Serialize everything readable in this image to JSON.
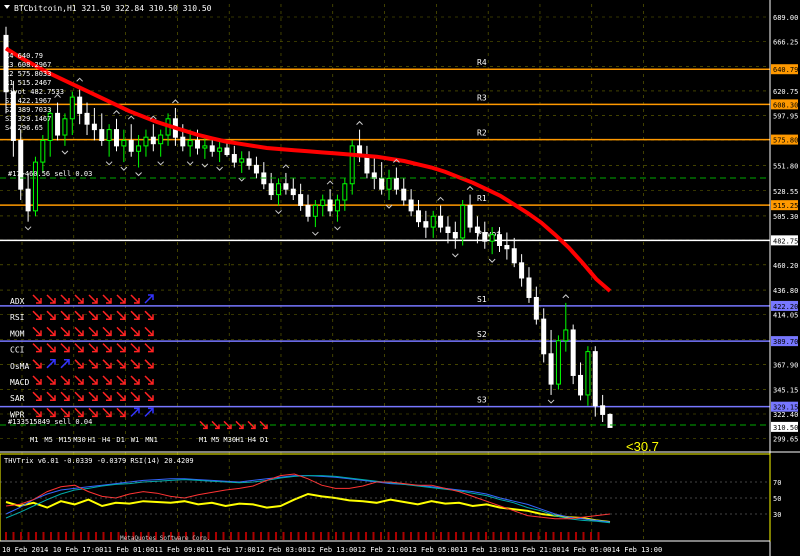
{
  "window": {
    "title": "BTCbitcoin,H1  321.50 322.84 310.50 310.50",
    "footer": "MetaQuotes Software Corp."
  },
  "colors": {
    "background": "#000000",
    "grid": "#6b6b00",
    "bull": "#00ff00",
    "bear": "#ffffff",
    "ma": "#ff0000",
    "pivot_line": "#ffffff",
    "res_line": "#ff9900",
    "sup_line": "#7777ff",
    "indicator_frame": "#ffff00"
  },
  "pivot_labels": [
    "R4 640.79",
    "R3 608.2967",
    "R2 575.8033",
    "R1 515.2467",
    "Pivot 482.7533",
    "S1 422.1967",
    "S2 389.7033",
    "S3 329.1467",
    "S4 296.65"
  ],
  "line_tags": {
    "R4": "R4",
    "R3": "R3",
    "R2": "R2",
    "R1": "R1",
    "Pivot": "Pivot",
    "S1": "S1",
    "S2": "S2",
    "S3": "S3"
  },
  "notes": {
    "sell_upper": "#17>460.56 sell 0.03",
    "sell_lower": "#133515849 sell 0.04",
    "big_label": "<30.7"
  },
  "mtf_table": {
    "rows": [
      "ADX",
      "RSI",
      "MOM",
      "CCI",
      "OsMA",
      "MACD",
      "SAR",
      "WPR"
    ],
    "periods_left": [
      "M1",
      "M5",
      "M15",
      "M30",
      "H1",
      "H4",
      "D1",
      "W1",
      "MN1"
    ],
    "periods_right": [
      "M1",
      "M5",
      "M30",
      "H1",
      "H4",
      "D1"
    ]
  },
  "indicator": {
    "label": "THVTrix v6.01 -0.0339 -0.0379  RSI(14) 20.4209",
    "levels": [
      "70",
      "50",
      "30"
    ]
  },
  "chart_data": [
    {
      "type": "candlestick",
      "title": "BTCbitcoin,H1",
      "symbol": "BTCbitcoin",
      "timeframe": "H1",
      "ohlc_header": {
        "open": 321.5,
        "high": 322.84,
        "low": 310.5,
        "close": 310.5
      },
      "y_ticks": [
        689.0,
        666.25,
        643.5,
        620.75,
        597.95,
        575.2,
        551.8,
        528.55,
        505.3,
        483.05,
        460.2,
        436.8,
        414.05,
        391.3,
        367.9,
        345.15,
        322.4,
        299.65
      ],
      "ylim": [
        291,
        701
      ],
      "x_ticks": [
        "10 Feb 2014",
        "10 Feb 17:00",
        "11 Feb 01:00",
        "11 Feb 09:00",
        "11 Feb 17:00",
        "12 Feb 03:00",
        "12 Feb 13:00",
        "12 Feb 21:00",
        "13 Feb 05:00",
        "13 Feb 13:00",
        "13 Feb 21:00",
        "14 Feb 05:00",
        "14 Feb 13:00"
      ],
      "price_tags": [
        {
          "label": "640.79",
          "value": 640.79,
          "kind": "res"
        },
        {
          "label": "608.30",
          "value": 608.3,
          "kind": "res"
        },
        {
          "label": "575.80",
          "value": 575.8,
          "kind": "res"
        },
        {
          "label": "515.25",
          "value": 515.25,
          "kind": "res"
        },
        {
          "label": "482.75",
          "value": 482.75,
          "kind": "pivot"
        },
        {
          "label": "422.20",
          "value": 422.2,
          "kind": "sup"
        },
        {
          "label": "389.70",
          "value": 389.7,
          "kind": "sup"
        },
        {
          "label": "329.15",
          "value": 329.15,
          "kind": "sup"
        },
        {
          "label": "310.50",
          "value": 310.5,
          "kind": "price"
        }
      ],
      "levels": {
        "R4": 640.79,
        "R3": 608.3,
        "R2": 575.8,
        "R1": 515.25,
        "Pivot": 482.75,
        "S1": 422.2,
        "S2": 389.7,
        "S3": 329.15
      },
      "candles": [
        [
          672,
          680,
          600,
          620
        ],
        [
          620,
          630,
          560,
          575
        ],
        [
          575,
          585,
          520,
          530
        ],
        [
          530,
          545,
          500,
          510
        ],
        [
          510,
          560,
          505,
          555
        ],
        [
          555,
          580,
          545,
          575
        ],
        [
          575,
          605,
          560,
          600
        ],
        [
          600,
          610,
          575,
          580
        ],
        [
          580,
          600,
          570,
          595
        ],
        [
          595,
          620,
          580,
          615
        ],
        [
          615,
          625,
          590,
          600
        ],
        [
          600,
          610,
          580,
          590
        ],
        [
          590,
          605,
          575,
          585
        ],
        [
          585,
          600,
          570,
          575
        ],
        [
          575,
          590,
          560,
          585
        ],
        [
          585,
          595,
          565,
          570
        ],
        [
          570,
          585,
          555,
          575
        ],
        [
          575,
          590,
          560,
          565
        ],
        [
          565,
          580,
          550,
          570
        ],
        [
          570,
          585,
          560,
          578
        ],
        [
          578,
          590,
          565,
          572
        ],
        [
          572,
          585,
          560,
          580
        ],
        [
          580,
          600,
          570,
          595
        ],
        [
          595,
          605,
          570,
          578
        ],
        [
          578,
          590,
          565,
          570
        ],
        [
          570,
          585,
          560,
          575
        ],
        [
          575,
          585,
          562,
          568
        ],
        [
          568,
          580,
          558,
          570
        ],
        [
          570,
          578,
          560,
          565
        ],
        [
          565,
          575,
          555,
          568
        ],
        [
          568,
          575,
          560,
          562
        ],
        [
          562,
          570,
          550,
          555
        ],
        [
          555,
          565,
          545,
          558
        ],
        [
          558,
          565,
          548,
          552
        ],
        [
          552,
          560,
          540,
          545
        ],
        [
          545,
          555,
          530,
          535
        ],
        [
          535,
          545,
          520,
          525
        ],
        [
          525,
          540,
          515,
          535
        ],
        [
          535,
          545,
          525,
          530
        ],
        [
          530,
          540,
          520,
          525
        ],
        [
          525,
          535,
          510,
          515
        ],
        [
          515,
          525,
          500,
          505
        ],
        [
          505,
          520,
          495,
          515
        ],
        [
          515,
          525,
          505,
          520
        ],
        [
          520,
          530,
          505,
          510
        ],
        [
          510,
          525,
          500,
          520
        ],
        [
          520,
          540,
          510,
          535
        ],
        [
          535,
          575,
          525,
          570
        ],
        [
          570,
          585,
          555,
          560
        ],
        [
          560,
          570,
          540,
          545
        ],
        [
          545,
          560,
          530,
          540
        ],
        [
          540,
          555,
          525,
          530
        ],
        [
          530,
          548,
          520,
          540
        ],
        [
          540,
          550,
          525,
          530
        ],
        [
          530,
          540,
          515,
          520
        ],
        [
          520,
          530,
          505,
          510
        ],
        [
          510,
          520,
          495,
          500
        ],
        [
          500,
          510,
          485,
          495
        ],
        [
          495,
          510,
          485,
          505
        ],
        [
          505,
          515,
          490,
          495
        ],
        [
          495,
          505,
          480,
          490
        ],
        [
          490,
          500,
          475,
          485
        ],
        [
          485,
          520,
          478,
          515
        ],
        [
          515,
          525,
          490,
          495
        ],
        [
          495,
          505,
          480,
          490
        ],
        [
          490,
          500,
          475,
          482
        ],
        [
          482,
          495,
          470,
          488
        ],
        [
          488,
          495,
          472,
          478
        ],
        [
          478,
          490,
          465,
          475
        ],
        [
          475,
          485,
          458,
          462
        ],
        [
          462,
          470,
          440,
          448
        ],
        [
          448,
          458,
          425,
          430
        ],
        [
          430,
          440,
          405,
          410
        ],
        [
          410,
          420,
          370,
          378
        ],
        [
          378,
          400,
          340,
          350
        ],
        [
          350,
          395,
          345,
          390
        ],
        [
          390,
          425,
          380,
          400
        ],
        [
          400,
          405,
          350,
          358
        ],
        [
          358,
          370,
          335,
          340
        ],
        [
          340,
          385,
          330,
          380
        ],
        [
          380,
          385,
          320,
          330
        ],
        [
          330,
          340,
          315,
          322
        ],
        [
          322,
          323,
          310,
          310
        ]
      ],
      "moving_average": [
        660,
        652,
        645,
        638,
        632,
        626,
        620,
        614,
        608,
        602,
        597,
        592,
        588,
        584,
        580,
        577,
        574,
        572,
        570,
        568,
        567,
        566,
        565,
        564,
        563,
        562,
        561,
        560,
        558,
        556,
        553,
        550,
        546,
        541,
        536,
        530,
        524,
        516,
        508,
        499,
        488,
        476,
        462,
        447,
        436
      ]
    },
    {
      "type": "line",
      "title": "THVTrix v6.01 -0.0339 -0.0379  RSI(14) 20.4209",
      "ylim": [
        0,
        100
      ],
      "y_ticks": [
        70,
        50,
        30
      ],
      "series": [
        {
          "name": "RSI(14)",
          "values": [
            45,
            40,
            44,
            38,
            46,
            42,
            48,
            40,
            44,
            43,
            46,
            45,
            44,
            46,
            42,
            44,
            40,
            43,
            42,
            38,
            40,
            48,
            55,
            52,
            50,
            47,
            46,
            44,
            48,
            45,
            42,
            46,
            43,
            44,
            40,
            42,
            38,
            36,
            34,
            30,
            28,
            26,
            25,
            22,
            20
          ]
        },
        {
          "name": "",
          "values": [
            30,
            38,
            48,
            55,
            60,
            62,
            64,
            66,
            68,
            70,
            72,
            73,
            74,
            74,
            73,
            72,
            71,
            70,
            72,
            74,
            76,
            78,
            78,
            77,
            76,
            74,
            72,
            70,
            68,
            67,
            66,
            64,
            62,
            60,
            58,
            55,
            50,
            46,
            42,
            36,
            30,
            26,
            24,
            22,
            20
          ]
        },
        {
          "name": "",
          "values": [
            25,
            32,
            40,
            48,
            55,
            60,
            62,
            65,
            67,
            68,
            70,
            71,
            72,
            73,
            72,
            71,
            70,
            69,
            70,
            72,
            75,
            77,
            78,
            78,
            77,
            75,
            73,
            71,
            69,
            67,
            65,
            63,
            61,
            59,
            56,
            53,
            48,
            44,
            38,
            34,
            28,
            24,
            22,
            21,
            19
          ]
        },
        {
          "name": "",
          "values": [
            40,
            42,
            48,
            58,
            64,
            66,
            58,
            52,
            50,
            55,
            58,
            56,
            52,
            50,
            54,
            57,
            60,
            62,
            65,
            72,
            78,
            80,
            74,
            66,
            62,
            62,
            65,
            70,
            70,
            68,
            66,
            66,
            62,
            58,
            52,
            46,
            40,
            34,
            28,
            26,
            24,
            24,
            26,
            28,
            30
          ]
        }
      ]
    }
  ]
}
